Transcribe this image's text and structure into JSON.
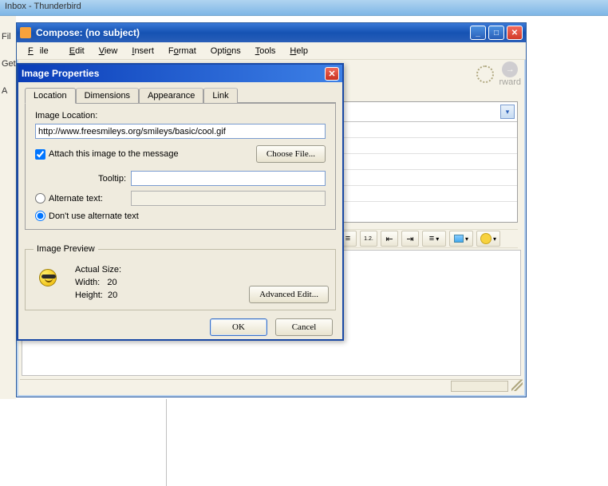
{
  "thunderbird": {
    "title": "Inbox - Thunderbird",
    "cut": {
      "file": "Fil",
      "get": "Get",
      "a": "A"
    }
  },
  "compose": {
    "title": "Compose: (no subject)",
    "menu": {
      "file": "File",
      "edit": "Edit",
      "view": "View",
      "insert": "Insert",
      "format": "Format",
      "options": "Options",
      "tools": "Tools",
      "help": "Help"
    },
    "forward": "rward"
  },
  "dialog": {
    "title": "Image Properties",
    "tabs": {
      "location": "Location",
      "dimensions": "Dimensions",
      "appearance": "Appearance",
      "link": "Link"
    },
    "loc": {
      "image_location_label": "Image Location:",
      "url": "http://www.freesmileys.org/smileys/basic/cool.gif",
      "attach_label": "Attach this image to the message",
      "choose_file": "Choose File...",
      "tooltip_label": "Tooltip:",
      "tooltip_value": "",
      "alt_label": "Alternate text:",
      "alt_value": "",
      "noalt_label": "Don't use alternate text"
    },
    "preview": {
      "legend": "Image Preview",
      "actual": "Actual Size:",
      "width_label": "Width:",
      "width": "20",
      "height_label": "Height:",
      "height": "20"
    },
    "adv": "Advanced Edit...",
    "ok": "OK",
    "cancel": "Cancel"
  },
  "fmt_icons": {
    "bullets": "≡",
    "numbers": "1.2.",
    "outdent": "⇤",
    "indent": "⇥",
    "align": "≡",
    "dd": "▾"
  }
}
